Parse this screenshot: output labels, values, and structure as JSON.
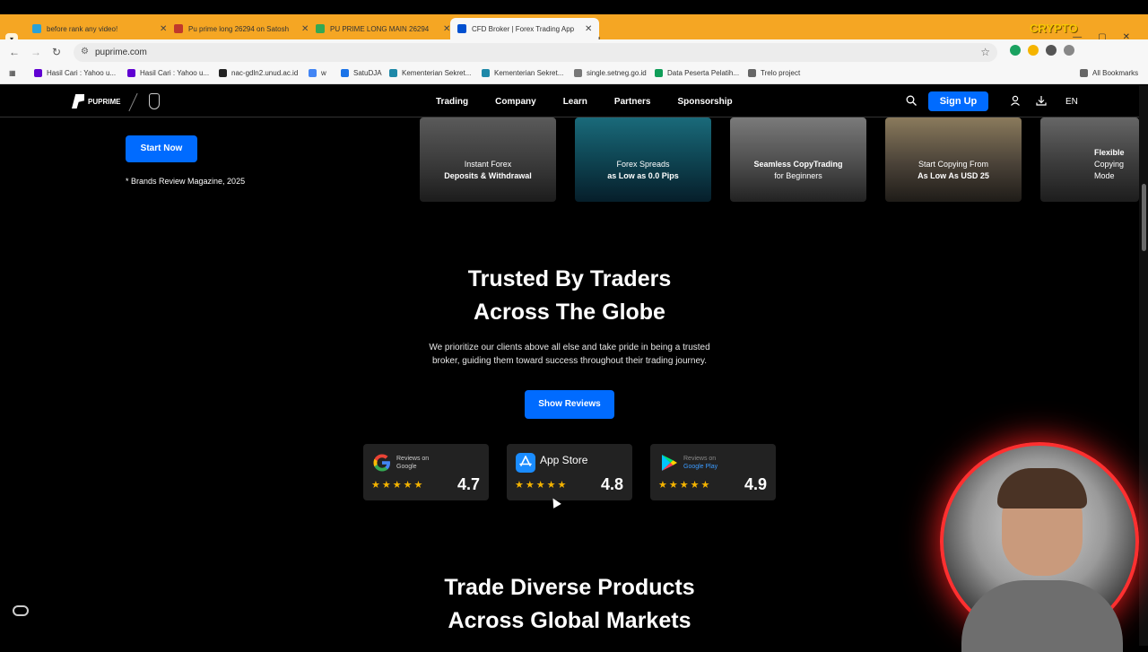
{
  "browser": {
    "tabs": [
      {
        "title": "before rank any video!",
        "color": "#2aa1d6"
      },
      {
        "title": "Pu prime long 26294 on Satosh",
        "color": "#c0392b"
      },
      {
        "title": "PU PRIME LONG MAIN 26294",
        "color": "#34a853"
      },
      {
        "title": "CFD Broker | Forex Trading App",
        "color": "#0050d0"
      }
    ],
    "url": "puprime.com",
    "bookmarks": [
      {
        "label": "Hasil Cari : Yahoo u...",
        "color": "#6001d2"
      },
      {
        "label": "Hasil Cari : Yahoo u...",
        "color": "#6001d2"
      },
      {
        "label": "nac-gdln2.unud.ac.id",
        "color": "#222222"
      },
      {
        "label": "w",
        "color": "#4285f4"
      },
      {
        "label": "SatuDJA",
        "color": "#1a73e8"
      },
      {
        "label": "Kementerian Sekret...",
        "color": "#1e88a8"
      },
      {
        "label": "Kementerian Sekret...",
        "color": "#1e88a8"
      },
      {
        "label": "single.setneg.go.id",
        "color": "#777777"
      },
      {
        "label": "Data Peserta Pelatih...",
        "color": "#0f9d58"
      },
      {
        "label": "Trelo project",
        "color": "#666666"
      }
    ],
    "all_bookmarks": "All Bookmarks",
    "overlay_logo": "CRYPTO"
  },
  "nav": {
    "logo_text": "PUPRIME",
    "menu": [
      "Trading",
      "Company",
      "Learn",
      "Partners",
      "Sponsorship"
    ],
    "signup": "Sign Up",
    "lang": "EN"
  },
  "hero": {
    "start_now": "Start Now",
    "note": "* Brands Review Magazine, 2025"
  },
  "cards": [
    {
      "line1": "Instant Forex",
      "line2": "Deposits & Withdrawal"
    },
    {
      "line1": "Forex Spreads",
      "line2": "as Low as 0.0 Pips"
    },
    {
      "line1": "Seamless CopyTrading",
      "line2": "for Beginners"
    },
    {
      "line1": "Start Copying From",
      "line2": "As Low As USD 25"
    },
    {
      "line1": "Flexible",
      "line2": "Copying Mode"
    }
  ],
  "trusted": {
    "title_line1": "Trusted By Traders",
    "title_line2": "Across The Globe",
    "desc_line1": "We prioritize our clients above all else and take pride in being a trusted",
    "desc_line2": "broker, guiding them toward success throughout their trading journey.",
    "button": "Show Reviews"
  },
  "reviews": [
    {
      "label1": "Reviews on",
      "label2": "Google",
      "score": "4.7",
      "stars": "★★★★★"
    },
    {
      "label1": "App Store",
      "label2": "",
      "score": "4.8",
      "stars": "★★★★★"
    },
    {
      "label1": "Reviews on",
      "label2": "Google Play",
      "score": "4.9",
      "stars": "★★★★★"
    }
  ],
  "trade": {
    "title_line1": "Trade Diverse Products",
    "title_line2": "Across Global Markets"
  },
  "colors": {
    "accent": "#006bff",
    "star": "#f5b400",
    "tabbar": "#f5a623"
  }
}
